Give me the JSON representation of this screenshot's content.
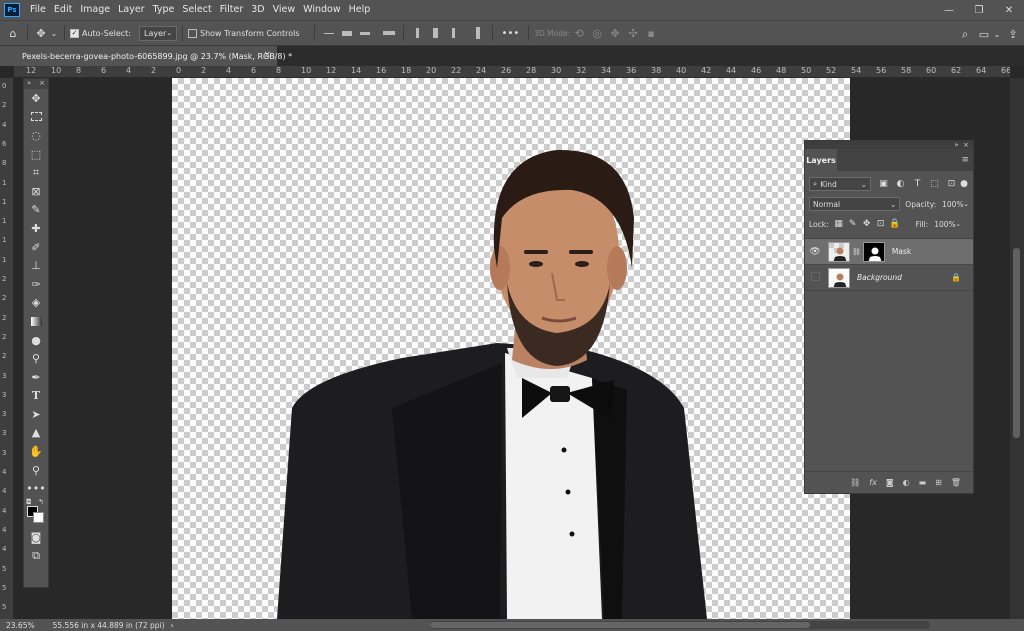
{
  "app": {
    "logo": "Ps"
  },
  "menu": [
    "File",
    "Edit",
    "Image",
    "Layer",
    "Type",
    "Select",
    "Filter",
    "3D",
    "View",
    "Window",
    "Help"
  ],
  "window_controls": {
    "minimize": "—",
    "restore": "❐",
    "close": "✕"
  },
  "options": {
    "auto_select_label": "Auto-Select:",
    "auto_select_target": "Layer",
    "transform_label": "Show Transform Controls",
    "more": "•••",
    "mode_3d_label": "3D Mode:"
  },
  "document": {
    "tab_title": "Pexels-becerra-govea-photo-6065899.jpg @ 23.7% (Mask, RGB/8) *",
    "close": "×"
  },
  "ruler_top": [
    "12",
    "10",
    "8",
    "6",
    "4",
    "2",
    "0",
    "2",
    "4",
    "6",
    "8",
    "10",
    "12",
    "14",
    "16",
    "18",
    "20",
    "22",
    "24",
    "26",
    "28",
    "30",
    "32",
    "34",
    "36",
    "38",
    "40",
    "42",
    "44",
    "46",
    "48",
    "50",
    "52",
    "54",
    "56",
    "58",
    "60",
    "62",
    "64",
    "66"
  ],
  "ruler_left": [
    "0",
    "2",
    "4",
    "6",
    "8",
    "1",
    "1",
    "1",
    "1",
    "1",
    "2",
    "2",
    "2",
    "2",
    "2",
    "3",
    "3",
    "3",
    "3",
    "3",
    "4",
    "4",
    "4",
    "4",
    "4",
    "5",
    "5",
    "5"
  ],
  "layers_panel": {
    "tab": "Layers",
    "filter_kind": "Kind",
    "blend_mode": "Normal",
    "opacity_label": "Opacity:",
    "opacity_value": "100%",
    "lock_label": "Lock:",
    "fill_label": "Fill:",
    "fill_value": "100%",
    "layers": [
      {
        "name": "Mask",
        "visible": true,
        "selected": true,
        "has_mask": true,
        "locked": false
      },
      {
        "name": "Background",
        "visible": false,
        "selected": false,
        "has_mask": false,
        "locked": true
      }
    ]
  },
  "status": {
    "zoom": "23.65%",
    "doc_info": "55.556 in x 44.889 in (72 ppi)"
  },
  "colors": {
    "foreground": "#000000",
    "background": "#ffffff",
    "accent": "#31a8ff"
  }
}
